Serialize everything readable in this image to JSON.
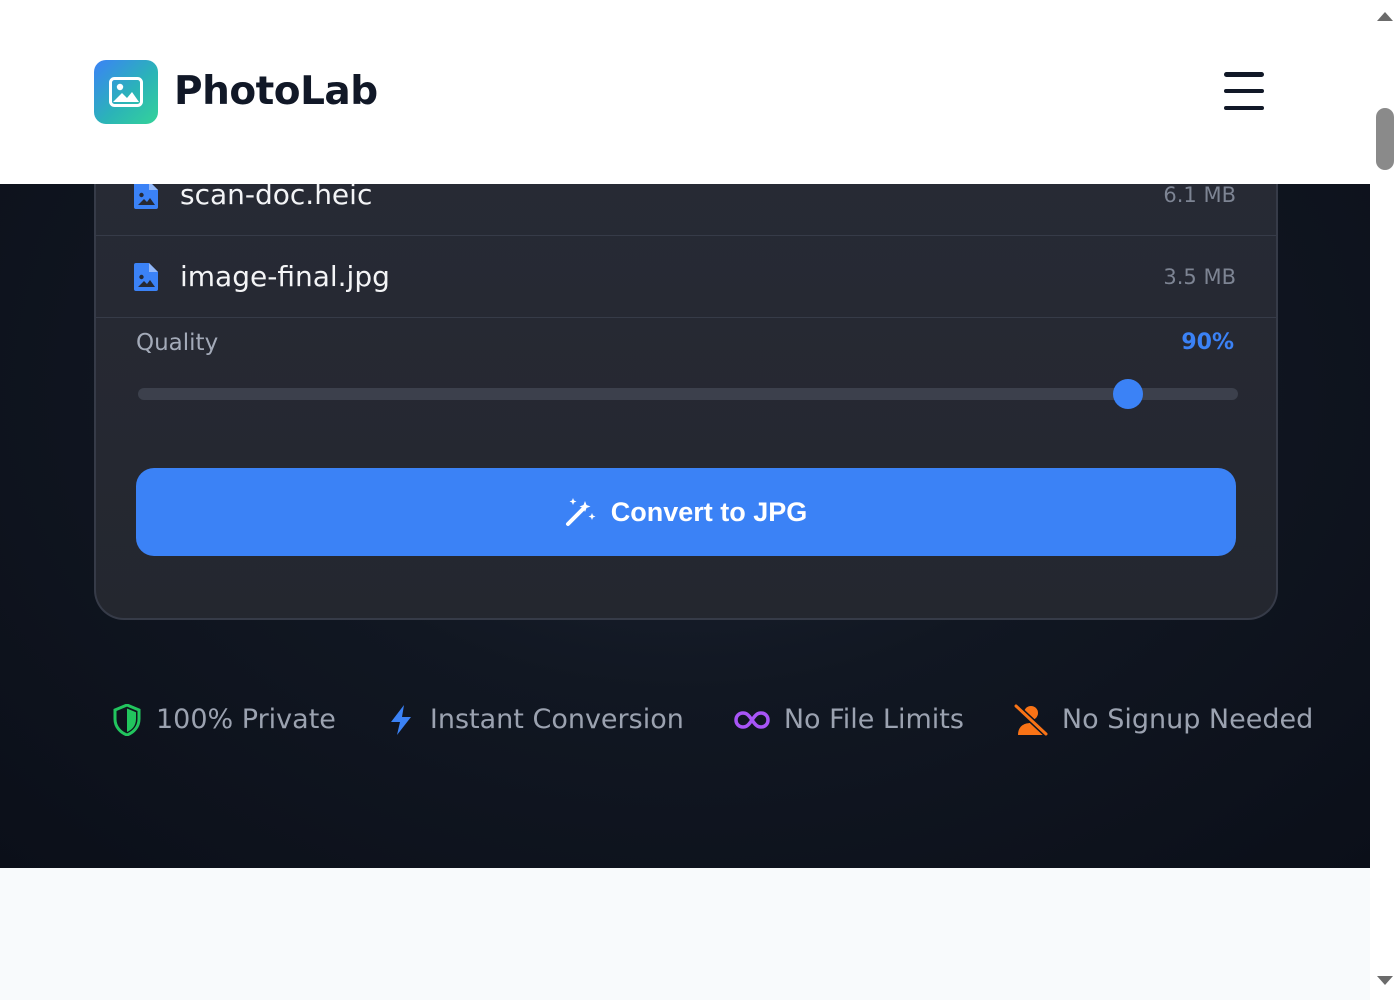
{
  "header": {
    "brand": "PhotoLab",
    "logo_icon": "image-icon",
    "menu_icon": "hamburger-icon"
  },
  "files": [
    {
      "name": "scan-doc.heic",
      "size": "6.1 MB",
      "icon": "file-image-icon"
    },
    {
      "name": "image-final.jpg",
      "size": "3.5 MB",
      "icon": "file-image-icon"
    }
  ],
  "quality": {
    "label": "Quality",
    "value_text": "90%",
    "value": 0.9
  },
  "convert_button": {
    "label": "Convert to JPG",
    "icon": "magic-wand-icon"
  },
  "features": [
    {
      "label": "100% Private",
      "icon": "shield-icon",
      "color": "#22c55e"
    },
    {
      "label": "Instant Conversion",
      "icon": "bolt-icon",
      "color": "#3b82f6"
    },
    {
      "label": "No File Limits",
      "icon": "infinity-icon",
      "color": "#a855f7"
    },
    {
      "label": "No Signup Needed",
      "icon": "user-slash-icon",
      "color": "#f97316"
    }
  ],
  "colors": {
    "accent": "#3b82f6",
    "hero_bg": "#0f1420",
    "card_bg": "#262933"
  }
}
